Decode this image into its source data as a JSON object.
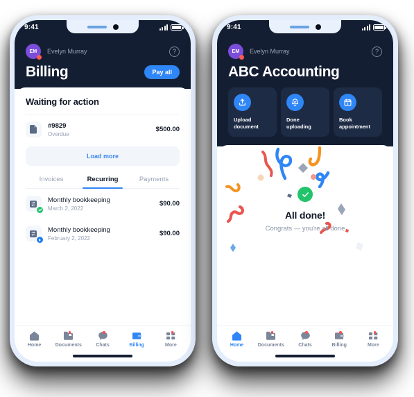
{
  "theme": {
    "dark_bg": "#141e33",
    "card_bg": "#1e2b45",
    "accent_blue": "#2f86f6",
    "green": "#22c36b",
    "avatar_purple": "#7b4ddb",
    "muted_text": "#98a2b6",
    "frame": "#e3edfb"
  },
  "phones": [
    {
      "id": "billing-phone",
      "status_bar": {
        "time": "9:41",
        "signal_icon": "signal-bars-icon",
        "battery_icon": "battery-icon"
      },
      "header": {
        "avatar_initials": "EM",
        "user_name": "Evelyn Murray",
        "help_icon": "help-circle-icon",
        "title": "Billing",
        "primary_action": "Pay all"
      },
      "sheet": {
        "section_title": "Waiting for action",
        "invoices": [
          {
            "icon": "document-icon",
            "id": "#9829",
            "status": "Overdue",
            "amount": "$500.00"
          }
        ],
        "load_more": "Load more",
        "tabs": [
          {
            "label": "Invoices",
            "active": false
          },
          {
            "label": "Recurring",
            "active": true
          },
          {
            "label": "Payments",
            "active": false
          }
        ],
        "recurring": [
          {
            "icon": "recurring-icon",
            "badge": "check-badge",
            "badge_color": "#22c36b",
            "name": "Monthly bookkeeping",
            "date": "March 2, 2022",
            "amount": "$90.00"
          },
          {
            "icon": "recurring-icon",
            "badge": "play-badge",
            "badge_color": "#1b7ef0",
            "name": "Monthly bookkeeping",
            "date": "February 2, 2022",
            "amount": "$90.00"
          }
        ]
      },
      "tabbar": [
        {
          "icon": "home-icon",
          "label": "Home",
          "active": false,
          "dot": false
        },
        {
          "icon": "documents-icon",
          "label": "Documents",
          "active": false,
          "dot": true
        },
        {
          "icon": "chats-icon",
          "label": "Chats",
          "active": false,
          "dot": true
        },
        {
          "icon": "billing-icon",
          "label": "Billing",
          "active": true,
          "dot": false
        },
        {
          "icon": "more-icon",
          "label": "More",
          "active": false,
          "dot": true
        }
      ]
    },
    {
      "id": "home-phone",
      "status_bar": {
        "time": "9:41",
        "signal_icon": "signal-bars-icon",
        "battery_icon": "battery-icon"
      },
      "header": {
        "avatar_initials": "EM",
        "user_name": "Evelyn Murray",
        "help_icon": "help-circle-icon",
        "title": "ABC Accounting"
      },
      "action_cards": [
        {
          "icon": "upload-icon",
          "label": "Upload\ndocument"
        },
        {
          "icon": "bell-check-icon",
          "label": "Done\nuploading"
        },
        {
          "icon": "calendar-icon",
          "label": "Book\nappointment"
        }
      ],
      "done_panel": {
        "check_icon": "check-circle-icon",
        "title": "All done!",
        "subtitle": "Congrats — you're all done",
        "confetti_colors": [
          "#e8564f",
          "#2f86f6",
          "#f59221",
          "#9aa5b8",
          "#f8d7b8",
          "#6aa9e8"
        ]
      },
      "tabbar": [
        {
          "icon": "home-icon",
          "label": "Home",
          "active": true,
          "dot": false
        },
        {
          "icon": "documents-icon",
          "label": "Documents",
          "active": false,
          "dot": true
        },
        {
          "icon": "chats-icon",
          "label": "Chats",
          "active": false,
          "dot": true
        },
        {
          "icon": "billing-icon",
          "label": "Billing",
          "active": false,
          "dot": true
        },
        {
          "icon": "more-icon",
          "label": "More",
          "active": false,
          "dot": true
        }
      ]
    }
  ]
}
